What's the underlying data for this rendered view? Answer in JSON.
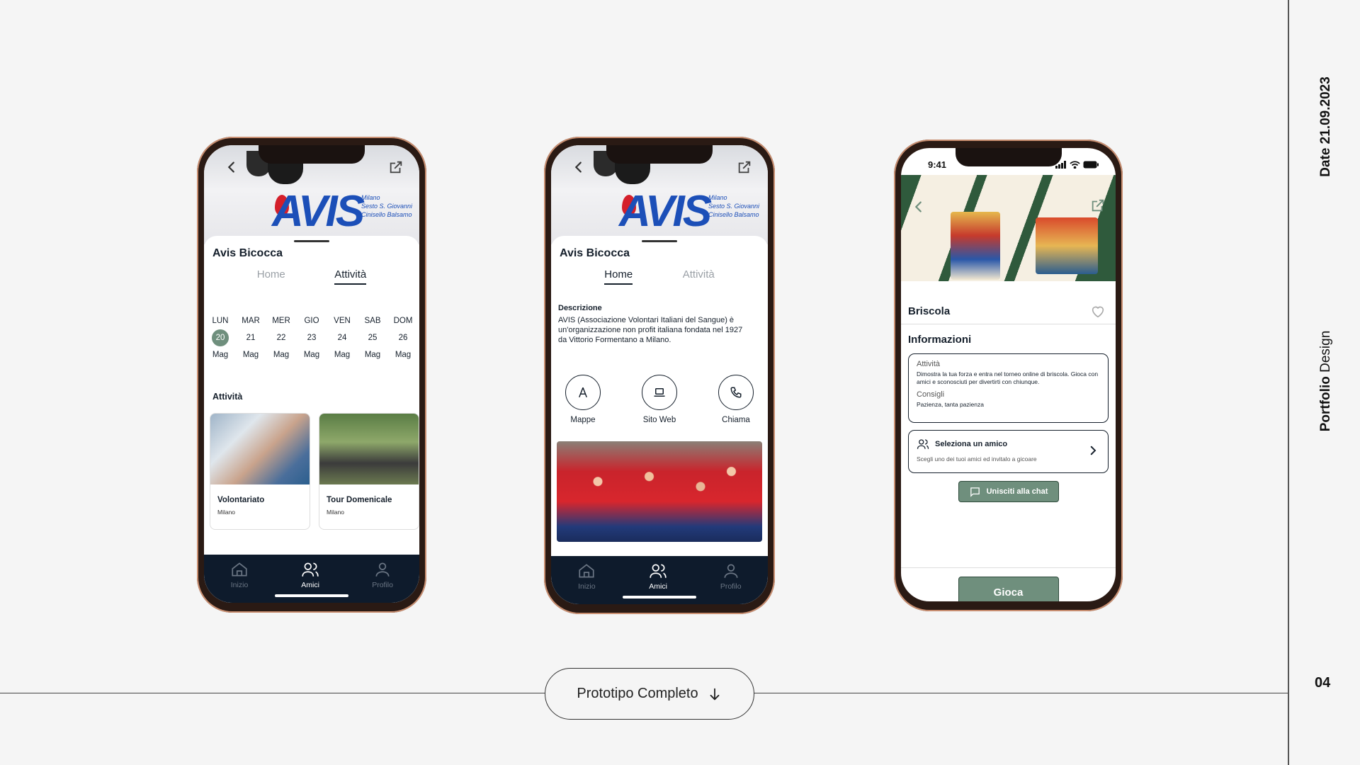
{
  "sidebar": {
    "date": "Date 21.09.2023",
    "portfolio_bold": "Portfolio",
    "portfolio_rest": " Design",
    "page_number": "04"
  },
  "prototype_button": {
    "label": "Prototipo Completo"
  },
  "phone1": {
    "org_title": "Avis Bicocca",
    "logo_text": "AVIS",
    "logo_sub": [
      "Milano",
      "Sesto S. Giovanni",
      "Cinisello Balsamo"
    ],
    "tabs": [
      "Home",
      "Attività"
    ],
    "active_tab": "Attività",
    "calendar": [
      {
        "day": "LUN",
        "num": "20",
        "month": "Mag",
        "selected": true
      },
      {
        "day": "MAR",
        "num": "21",
        "month": "Mag"
      },
      {
        "day": "MER",
        "num": "22",
        "month": "Mag"
      },
      {
        "day": "GIO",
        "num": "23",
        "month": "Mag"
      },
      {
        "day": "VEN",
        "num": "24",
        "month": "Mag"
      },
      {
        "day": "SAB",
        "num": "25",
        "month": "Mag"
      },
      {
        "day": "DOM",
        "num": "26",
        "month": "Mag"
      }
    ],
    "section_label": "Attività",
    "cards": [
      {
        "title": "Volontariato",
        "subtitle": "Milano"
      },
      {
        "title": "Tour Domenicale",
        "subtitle": "Milano"
      }
    ]
  },
  "phone2": {
    "org_title": "Avis Bicocca",
    "logo_text": "AVIS",
    "logo_sub": [
      "Milano",
      "Sesto S. Giovanni",
      "Cinisello Balsamo"
    ],
    "tabs": [
      "Home",
      "Attività"
    ],
    "active_tab": "Home",
    "description_heading": "Descrizione",
    "description": "AVIS (Associazione Volontari Italiani del Sangue) è un'organizzazione non profit italiana fondata nel 1927 da Vittorio Formentano a Milano.",
    "actions": [
      {
        "label": "Mappe",
        "icon": "map-icon"
      },
      {
        "label": "Sito Web",
        "icon": "laptop-icon"
      },
      {
        "label": "Chiama",
        "icon": "phone-icon"
      }
    ]
  },
  "tabbar": {
    "items": [
      {
        "label": "Inizio",
        "icon": "home-icon"
      },
      {
        "label": "Amici",
        "icon": "friends-icon",
        "active": true
      },
      {
        "label": "Profilo",
        "icon": "profile-icon"
      }
    ]
  },
  "phone3": {
    "time": "9:41",
    "game_title": "Briscola",
    "info_heading": "Informazioni",
    "info": {
      "activity_label": "Attività",
      "activity_text": "Dimostra la tua forza e entra nel torneo online di briscola. Gioca con amici e sconosciuti per divertirti con chiunque.",
      "tips_label": "Consigli",
      "tips_text": "Pazienza, tanta pazienza"
    },
    "friend": {
      "title": "Seleziona un amico",
      "hint": "Scegli uno dei tuoi amici ed invitalo a gicoare"
    },
    "chat_button": "Unisciti alla chat",
    "play_button": "Gioca"
  },
  "colors": {
    "accent": "#6f8f7d",
    "navbar": "#0e1b2c",
    "text": "#16202c",
    "avis_blue": "#1c4fb8",
    "avis_red": "#d41f2a"
  }
}
